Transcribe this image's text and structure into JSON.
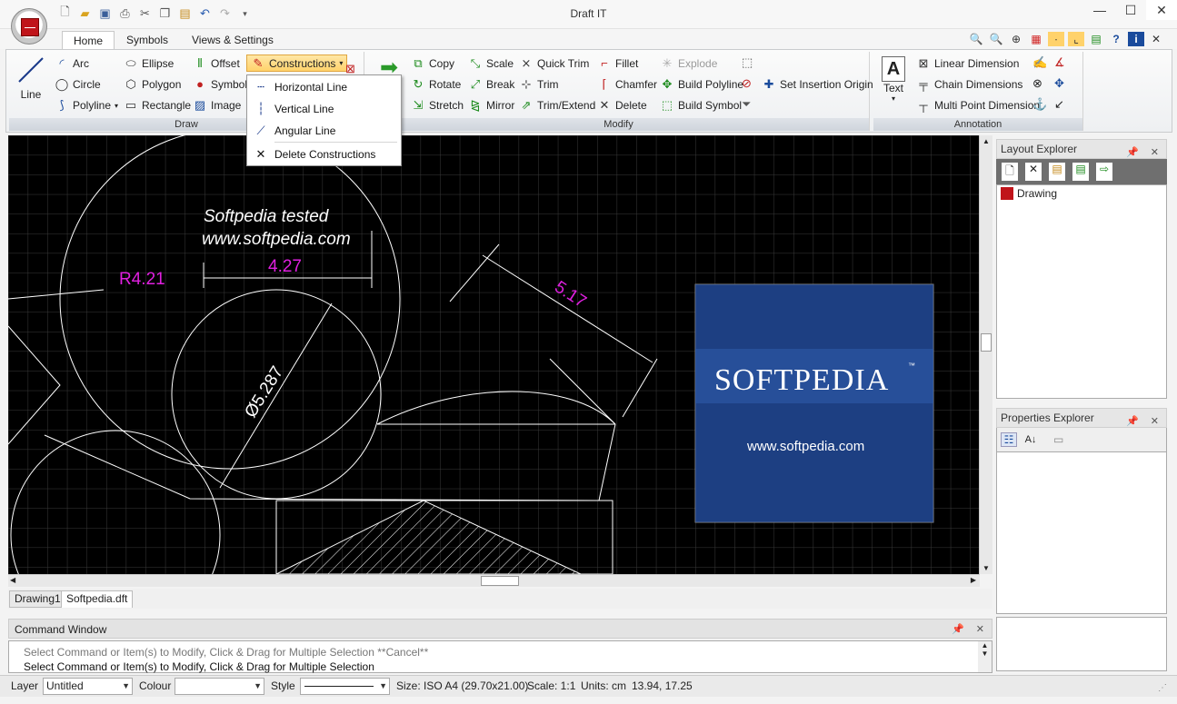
{
  "app": {
    "title": "Draft IT"
  },
  "qat": {
    "icons": [
      "new-icon",
      "open-icon",
      "save-icon",
      "print-icon",
      "cut-icon",
      "copy-icon",
      "paste-icon",
      "undo-icon",
      "redo-icon"
    ]
  },
  "tabs": [
    {
      "label": "Home"
    },
    {
      "label": "Symbols"
    },
    {
      "label": "Views & Settings"
    }
  ],
  "draw": {
    "line": "Line",
    "arc": "Arc",
    "circle": "Circle",
    "polyline": "Polyline",
    "ellipse": "Ellipse",
    "polygon": "Polygon",
    "rectangle": "Rectangle",
    "offset": "Offset",
    "symbol": "Symbol",
    "image": "Image",
    "constructions": "Constructions",
    "group": "Draw"
  },
  "constructions_menu": [
    {
      "label": "Horizontal Line"
    },
    {
      "label": "Vertical Line"
    },
    {
      "label": "Angular Line"
    },
    {
      "label": "Delete Constructions"
    }
  ],
  "modify": {
    "copy": "Copy",
    "rotate": "Rotate",
    "stretch": "Stretch",
    "scale": "Scale",
    "break": "Break",
    "mirror": "Mirror",
    "quick_trim": "Quick Trim",
    "trim": "Trim",
    "trim_extend": "Trim/Extend",
    "fillet": "Fillet",
    "chamfer": "Chamfer",
    "delete": "Delete",
    "explode": "Explode",
    "build_polyline": "Build Polyline",
    "build_symbol": "Build Symbol",
    "set_insertion_origin": "Set Insertion Origin",
    "group": "Modify"
  },
  "annotation": {
    "text": "Text",
    "linear_dimension": "Linear Dimension",
    "chain_dimensions": "Chain Dimensions",
    "multi_point_dimension": "Multi Point Dimension",
    "group": "Annotation"
  },
  "canvas": {
    "watermark_line1": "Softpedia  tested",
    "watermark_line2": "www.softpedia.com",
    "dim_r": "R4.21",
    "dim_w": "4.27",
    "dim_diag": "5.17",
    "dim_dia": "Ø5.287",
    "logo_text": "SOFTPEDIA",
    "logo_tm": "™",
    "logo_url": "www.softpedia.com"
  },
  "doc_tabs": [
    {
      "label": "Drawing1"
    },
    {
      "label": "Softpedia.dft"
    }
  ],
  "layout_explorer": {
    "title": "Layout Explorer",
    "item": "Drawing"
  },
  "properties_explorer": {
    "title": "Properties Explorer"
  },
  "command_window": {
    "title": "Command Window",
    "line1": "Select Command or Item(s) to Modify, Click & Drag for Multiple Selection  **Cancel**",
    "line2": "Select Command or Item(s) to Modify, Click & Drag for Multiple Selection"
  },
  "status": {
    "layer_label": "Layer",
    "layer_value": "Untitled",
    "colour_label": "Colour",
    "colour_value": "",
    "style_label": "Style",
    "size": "Size: ISO A4 (29.70x21.00)",
    "scale": "Scale: 1:1",
    "units": "Units: cm",
    "coords": "13.94, 17.25"
  },
  "colors": {
    "dimension": "#e020e0",
    "canvas": "#000000",
    "grid": "#3a3a3a",
    "ribbon_active": "#ffd26b"
  }
}
